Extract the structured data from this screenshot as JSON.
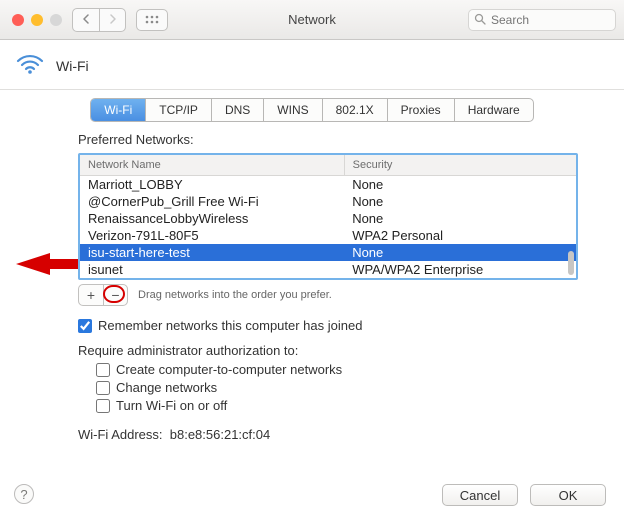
{
  "window": {
    "title": "Network"
  },
  "search": {
    "placeholder": "Search"
  },
  "header": {
    "interface": "Wi-Fi"
  },
  "tabs": [
    {
      "label": "Wi-Fi",
      "active": true
    },
    {
      "label": "TCP/IP"
    },
    {
      "label": "DNS"
    },
    {
      "label": "WINS"
    },
    {
      "label": "802.1X"
    },
    {
      "label": "Proxies"
    },
    {
      "label": "Hardware"
    }
  ],
  "preferred": {
    "title": "Preferred Networks:",
    "columns": {
      "name": "Network Name",
      "security": "Security"
    },
    "rows": [
      {
        "name": "Marriott_LOBBY",
        "security": "None"
      },
      {
        "name": "@CornerPub_Grill Free Wi-Fi",
        "security": "None"
      },
      {
        "name": "RenaissanceLobbyWireless",
        "security": "None"
      },
      {
        "name": "Verizon-791L-80F5",
        "security": "WPA2 Personal"
      },
      {
        "name": "isu-start-here-test",
        "security": "None",
        "selected": true
      },
      {
        "name": "isunet",
        "security": "WPA/WPA2 Enterprise"
      }
    ],
    "hint": "Drag networks into the order you prefer."
  },
  "options": {
    "remember": "Remember networks this computer has joined",
    "remember_checked": true,
    "require_label": "Require administrator authorization to:",
    "create_c2c": "Create computer-to-computer networks",
    "change_networks": "Change networks",
    "toggle_wifi": "Turn Wi-Fi on or off"
  },
  "address": {
    "label": "Wi-Fi Address:",
    "value": "b8:e8:56:21:cf:04"
  },
  "footer": {
    "cancel": "Cancel",
    "ok": "OK"
  },
  "help": {
    "glyph": "?"
  },
  "pm": {
    "plus": "+",
    "minus": "−"
  }
}
